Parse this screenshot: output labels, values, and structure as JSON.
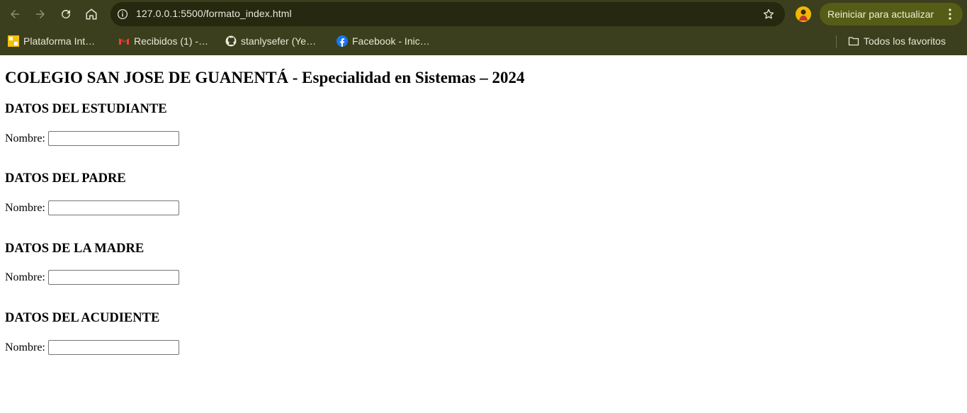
{
  "browser": {
    "url": "127.0.0.1:5500/formato_index.html",
    "update_button_label": "Reiniciar para actualizar",
    "bookmarks": [
      {
        "label": "Plataforma Int…",
        "icon": "plataforma-icon"
      },
      {
        "label": "Recibidos (1) -…",
        "icon": "gmail-icon"
      },
      {
        "label": "stanlysefer (Ye…",
        "icon": "github-icon"
      },
      {
        "label": "Facebook - Inic…",
        "icon": "facebook-icon"
      }
    ],
    "all_bookmarks_label": "Todos los favoritos"
  },
  "page": {
    "title": "COLEGIO SAN JOSE DE GUANENTÁ - Especialidad en Sistemas – 2024",
    "sections": [
      {
        "heading": "DATOS DEL ESTUDIANTE",
        "field_label": "Nombre:",
        "value": ""
      },
      {
        "heading": "DATOS DEL PADRE",
        "field_label": "Nombre:",
        "value": ""
      },
      {
        "heading": "DATOS DE LA MADRE",
        "field_label": "Nombre:",
        "value": ""
      },
      {
        "heading": "DATOS DEL ACUDIENTE",
        "field_label": "Nombre:",
        "value": ""
      }
    ]
  },
  "colors": {
    "chrome_bg": "#3b3f1d",
    "omnibox_bg": "#26280f",
    "update_button_bg": "#545c16"
  }
}
